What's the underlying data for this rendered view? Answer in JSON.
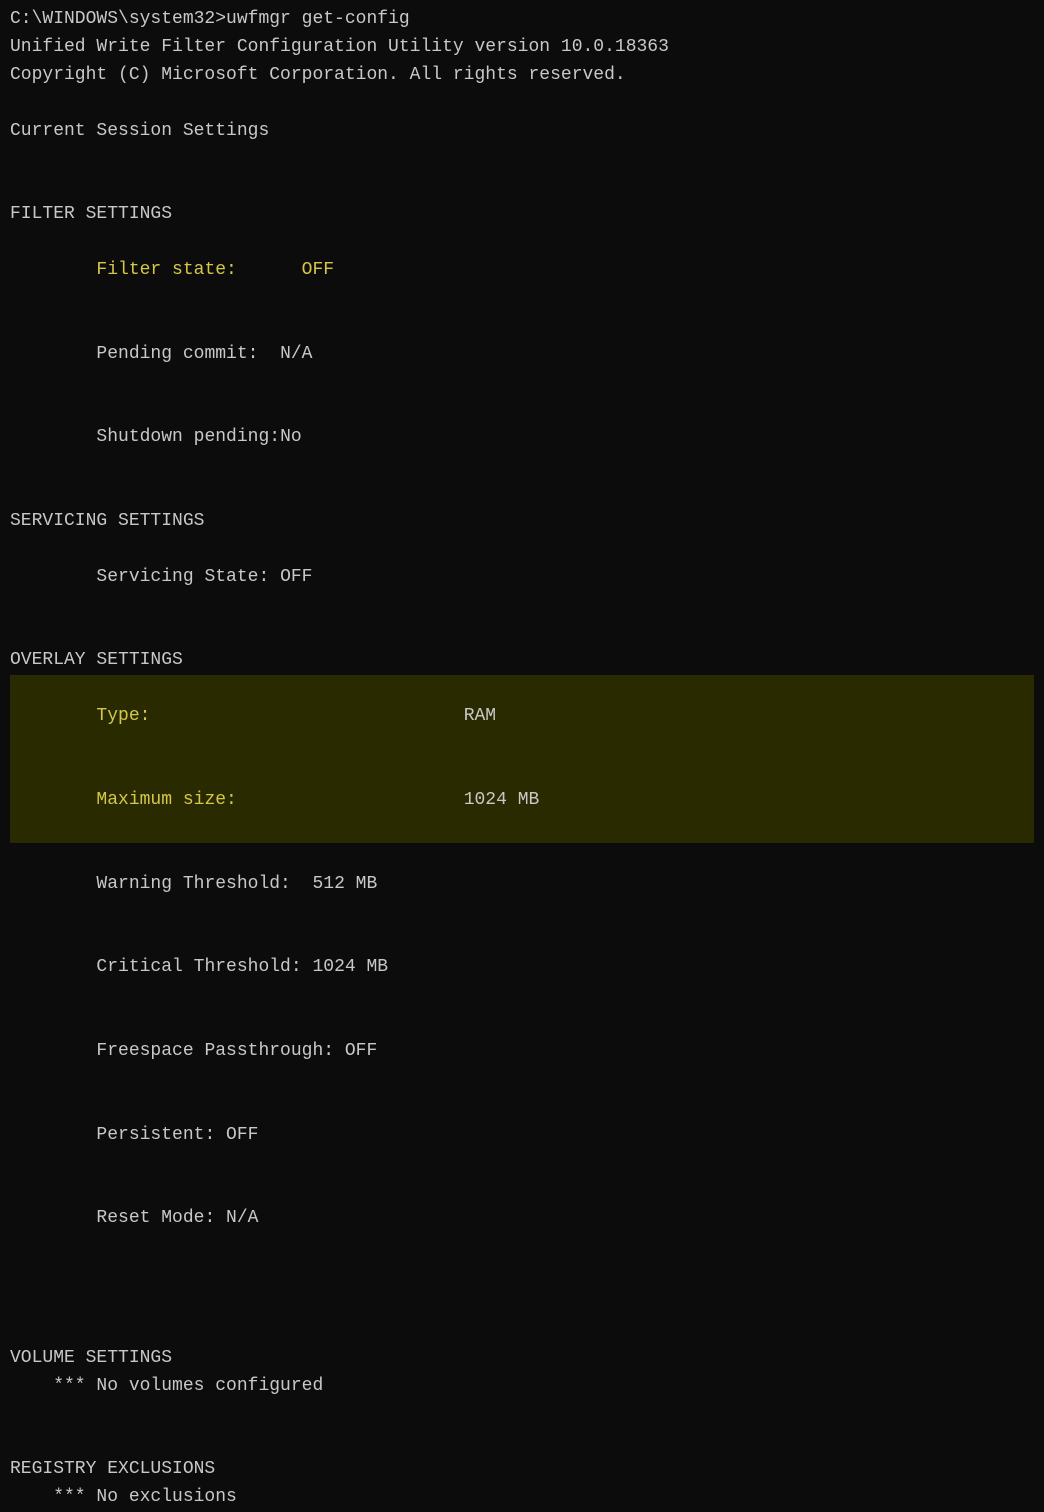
{
  "terminal": {
    "prompt_line": "C:\\WINDOWS\\system32>uwfmgr get-config",
    "utility_title": "Unified Write Filter Configuration Utility version 10.0.18363",
    "copyright": "Copyright (C) Microsoft Corporation. All rights reserved.",
    "current_session_header": "Current Session Settings",
    "filter_settings_header": "FILTER SETTINGS",
    "filter_state_label": "    Filter state:      ",
    "filter_state_value": "OFF",
    "pending_commit_label": "    Pending commit:  ",
    "pending_commit_value": "N/A",
    "shutdown_pending_label": "    Shutdown pending:",
    "shutdown_pending_value": "No",
    "servicing_settings_header": "SERVICING SETTINGS",
    "servicing_state_label": "    Servicing State: ",
    "servicing_state_value": "OFF",
    "overlay_settings_header": "OVERLAY SETTINGS",
    "type_label": "    Type:                             ",
    "type_value": "RAM",
    "max_size_label": "    Maximum size:                     ",
    "max_size_value": "1024 MB",
    "warning_threshold_label": "    Warning Threshold:  ",
    "warning_threshold_value": "512 MB",
    "critical_threshold_label": "    Critical Threshold: ",
    "critical_threshold_value": "1024 MB",
    "freespace_passthrough_label": "    Freespace Passthrough: ",
    "freespace_passthrough_value": "OFF",
    "persistent_label": "    Persistent: ",
    "persistent_value": "OFF",
    "reset_mode_label": "    Reset Mode: ",
    "reset_mode_value": "N/A",
    "volume_settings_header": "VOLUME SETTINGS",
    "no_volumes": "    *** No volumes configured",
    "registry_exclusions_header": "REGISTRY EXCLUSIONS",
    "no_exclusions": "    *** No exclusions"
  }
}
